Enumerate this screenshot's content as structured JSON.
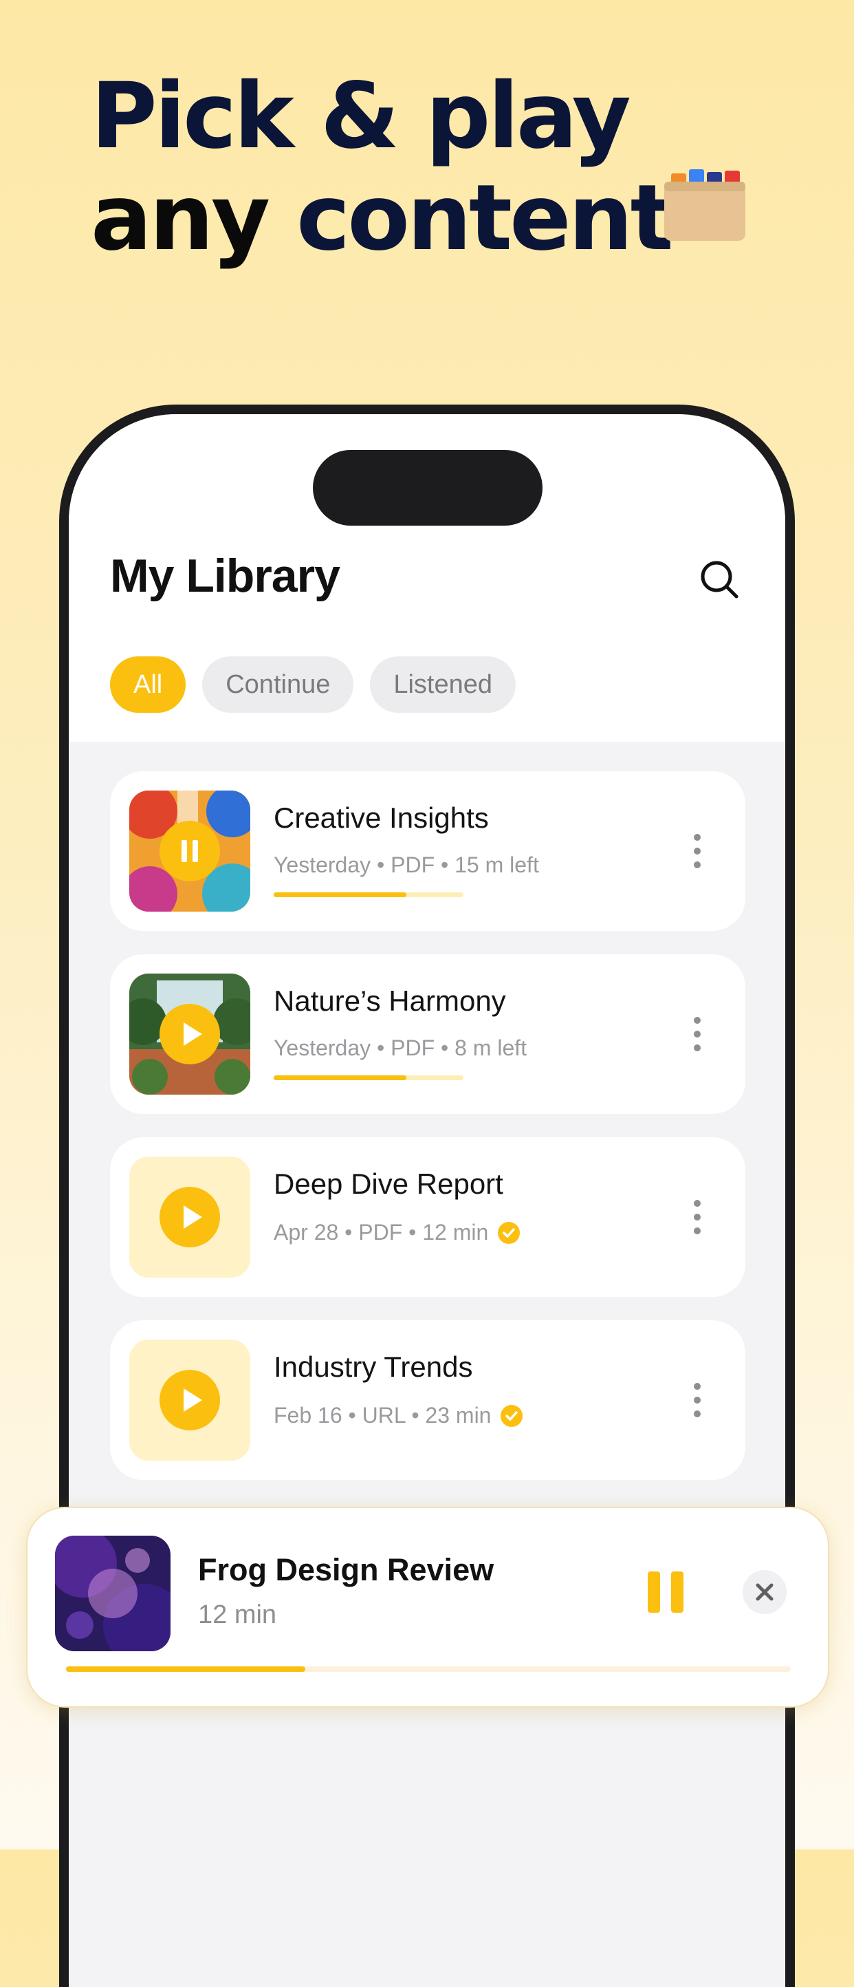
{
  "headline": {
    "line1": "Pick & play",
    "line2_dark": "any",
    "line2_accent": "content"
  },
  "library": {
    "title": "My Library",
    "filters": [
      {
        "label": "All",
        "active": true
      },
      {
        "label": "Continue",
        "active": false
      },
      {
        "label": "Listened",
        "active": false
      }
    ],
    "items": [
      {
        "title": "Creative Insights",
        "meta": "Yesterday • PDF • 15 m left",
        "state": "playing",
        "progress": 0.7,
        "completed": false
      },
      {
        "title": "Nature’s Harmony",
        "meta": "Yesterday • PDF • 8 m left",
        "state": "paused",
        "progress": 0.7,
        "completed": false
      },
      {
        "title": "Deep Dive Report",
        "meta": "Apr 28 • PDF • 12 min",
        "state": "paused",
        "progress": null,
        "completed": true
      },
      {
        "title": "Industry Trends",
        "meta": "Feb 16 • URL • 23 min",
        "state": "paused",
        "progress": null,
        "completed": true
      }
    ]
  },
  "player": {
    "title": "Frog Design Review",
    "subtitle": "12 min",
    "progress": 0.33,
    "state": "playing"
  },
  "colors": {
    "accent": "#fbbf0f",
    "headline": "#0b1538",
    "background_top": "#fde8a6"
  }
}
